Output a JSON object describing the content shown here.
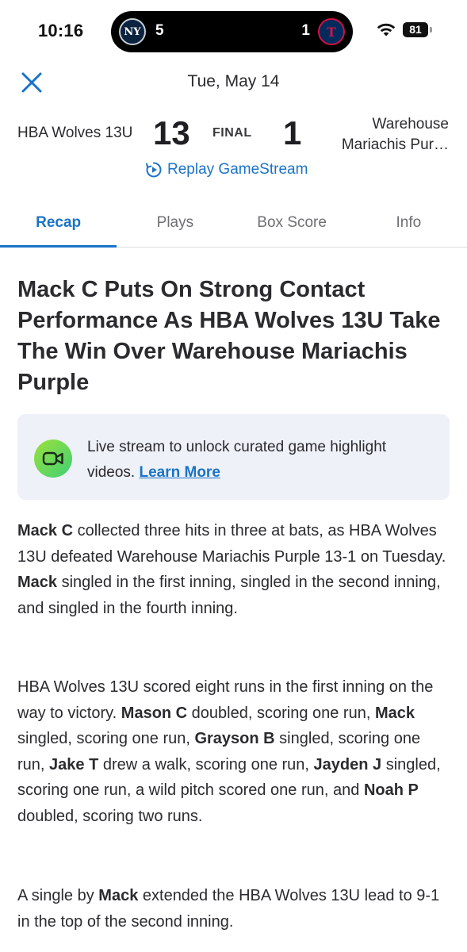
{
  "status_bar": {
    "time": "10:16",
    "live_activity": {
      "away_logo": "NY",
      "away_score": "5",
      "home_score": "1",
      "home_logo": "T"
    },
    "battery": "81",
    "icons": [
      "wifi-icon",
      "battery-icon"
    ]
  },
  "header": {
    "close_icon": "close-icon",
    "date": "Tue, May 14"
  },
  "scoreboard": {
    "home_team": "HBA Wolves 13U",
    "home_score": "13",
    "status": "FINAL",
    "away_score": "1",
    "away_team_line1": "Warehouse",
    "away_team_line2": "Mariachis Pur…",
    "replay_label": "Replay GameStream"
  },
  "tabs": [
    {
      "label": "Recap",
      "active": true
    },
    {
      "label": "Plays",
      "active": false
    },
    {
      "label": "Box Score",
      "active": false
    },
    {
      "label": "Info",
      "active": false
    }
  ],
  "article": {
    "headline": "Mack C Puts On Strong Contact Performance As HBA Wolves 13U Take The Win Over Warehouse Mariachis Purple",
    "promo": {
      "text": "Live stream to unlock curated game highlight videos.",
      "link": "Learn More"
    },
    "p1": {
      "name1": "Mack C",
      "t1": " collected three hits in three at bats, as HBA Wolves 13U defeated Warehouse Mariachis Purple 13-1 on Tuesday. ",
      "name2": "Mack",
      "t2": " singled in the first inning, singled in the second inning, and singled in the fourth inning."
    },
    "p2": {
      "t0": "HBA Wolves 13U scored eight runs in the first inning on the way to victory.  ",
      "n1": "Mason C",
      "t1": " doubled, scoring one run, ",
      "n2": "Mack",
      "t2": " singled, scoring one run, ",
      "n3": "Grayson B",
      "t3": " singled, scoring one run, ",
      "n4": "Jake T",
      "t4": " drew a walk, scoring one run, ",
      "n5": "Jayden J",
      "t5": " singled, scoring one run, a wild pitch scored one run, and ",
      "n6": "Noah P",
      "t6": " doubled, scoring two runs."
    },
    "p3": {
      "t0": "A single by ",
      "n1": "Mack",
      "t1": " extended the HBA Wolves 13U lead to 9-1 in the top of the second inning."
    }
  },
  "colors": {
    "accent": "#1a73c8",
    "text": "#2b2b2f",
    "promo_bg": "#eef1f7"
  }
}
